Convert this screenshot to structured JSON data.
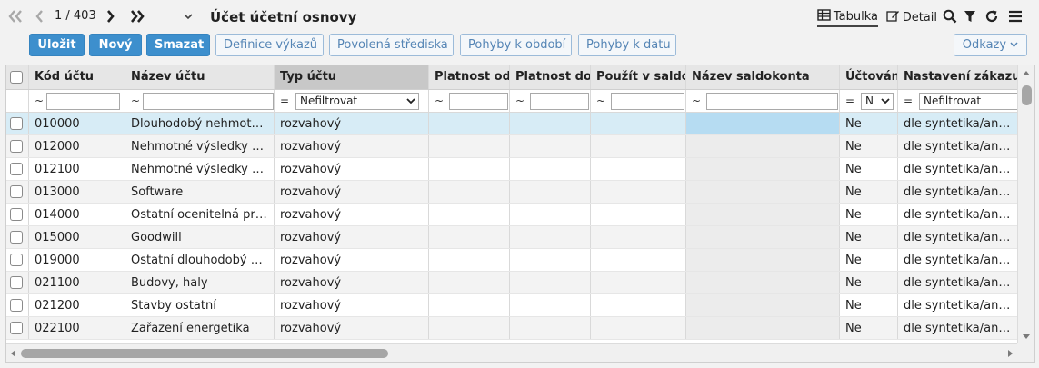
{
  "toolbar": {
    "pager": "1 / 403",
    "title": "Účet účetní osnovy",
    "views": {
      "table": "Tabulka",
      "detail": "Detail"
    }
  },
  "actions": {
    "save": "Uložit",
    "new": "Nový",
    "delete": "Smazat",
    "report_def": "Definice výkazů",
    "centers": "Povolená střediska",
    "moves_period": "Pohyby k období",
    "moves_date": "Pohyby k datu",
    "links": "Odkazy"
  },
  "grid": {
    "columns": [
      {
        "label": "Kód účtu"
      },
      {
        "label": "Název účtu"
      },
      {
        "label": "Typ účtu"
      },
      {
        "label": "Platnost od"
      },
      {
        "label": "Platnost do"
      },
      {
        "label": "Použít v saldokontu"
      },
      {
        "label": "Název saldokonta"
      },
      {
        "label": "Účtování zakázek"
      },
      {
        "label": "Nastavení zákazu účtování"
      }
    ],
    "filters": {
      "tilde": "~",
      "eq": "=",
      "type_select": "Nefiltrovat",
      "order_select": "N",
      "setting_select": "Nefiltrovat"
    },
    "rows": [
      {
        "code": "010000",
        "name": "Dlouhodobý nehmotný majetek",
        "type": "rozvahový",
        "valid_from": "",
        "valid_to": "",
        "use_saldo": "",
        "saldo_name": "",
        "orders": "Ne",
        "setting": "dle syntetika/analytiky"
      },
      {
        "code": "012000",
        "name": "Nehmotné výsledky vývoje",
        "type": "rozvahový",
        "valid_from": "",
        "valid_to": "",
        "use_saldo": "",
        "saldo_name": "",
        "orders": "Ne",
        "setting": "dle syntetika/analytiky"
      },
      {
        "code": "012100",
        "name": "Nehmotné výsledky výzkumu",
        "type": "rozvahový",
        "valid_from": "",
        "valid_to": "",
        "use_saldo": "",
        "saldo_name": "",
        "orders": "Ne",
        "setting": "dle syntetika/analytiky"
      },
      {
        "code": "013000",
        "name": "Software",
        "type": "rozvahový",
        "valid_from": "",
        "valid_to": "",
        "use_saldo": "",
        "saldo_name": "",
        "orders": "Ne",
        "setting": "dle syntetika/analytiky"
      },
      {
        "code": "014000",
        "name": "Ostatní ocenitelná práva",
        "type": "rozvahový",
        "valid_from": "",
        "valid_to": "",
        "use_saldo": "",
        "saldo_name": "",
        "orders": "Ne",
        "setting": "dle syntetika/analytiky"
      },
      {
        "code": "015000",
        "name": "Goodwill",
        "type": "rozvahový",
        "valid_from": "",
        "valid_to": "",
        "use_saldo": "",
        "saldo_name": "",
        "orders": "Ne",
        "setting": "dle syntetika/analytiky"
      },
      {
        "code": "019000",
        "name": "Ostatní dlouhodobý nehmotný majetek",
        "type": "rozvahový",
        "valid_from": "",
        "valid_to": "",
        "use_saldo": "",
        "saldo_name": "",
        "orders": "Ne",
        "setting": "dle syntetika/analytiky"
      },
      {
        "code": "021100",
        "name": "Budovy, haly",
        "type": "rozvahový",
        "valid_from": "",
        "valid_to": "",
        "use_saldo": "",
        "saldo_name": "",
        "orders": "Ne",
        "setting": "dle syntetika/analytiky"
      },
      {
        "code": "021200",
        "name": "Stavby ostatní",
        "type": "rozvahový",
        "valid_from": "",
        "valid_to": "",
        "use_saldo": "",
        "saldo_name": "",
        "orders": "Ne",
        "setting": "dle syntetika/analytiky"
      },
      {
        "code": "022100",
        "name": "Zařazení energetika",
        "type": "rozvahový",
        "valid_from": "",
        "valid_to": "",
        "use_saldo": "",
        "saldo_name": "",
        "orders": "Ne",
        "setting": "dle syntetika/analytiky"
      }
    ]
  },
  "colors": {
    "primary_button": "#3d8fcd",
    "selected_row": "#d7ecf6",
    "selected_saldo_cell": "#b6dcf2"
  }
}
